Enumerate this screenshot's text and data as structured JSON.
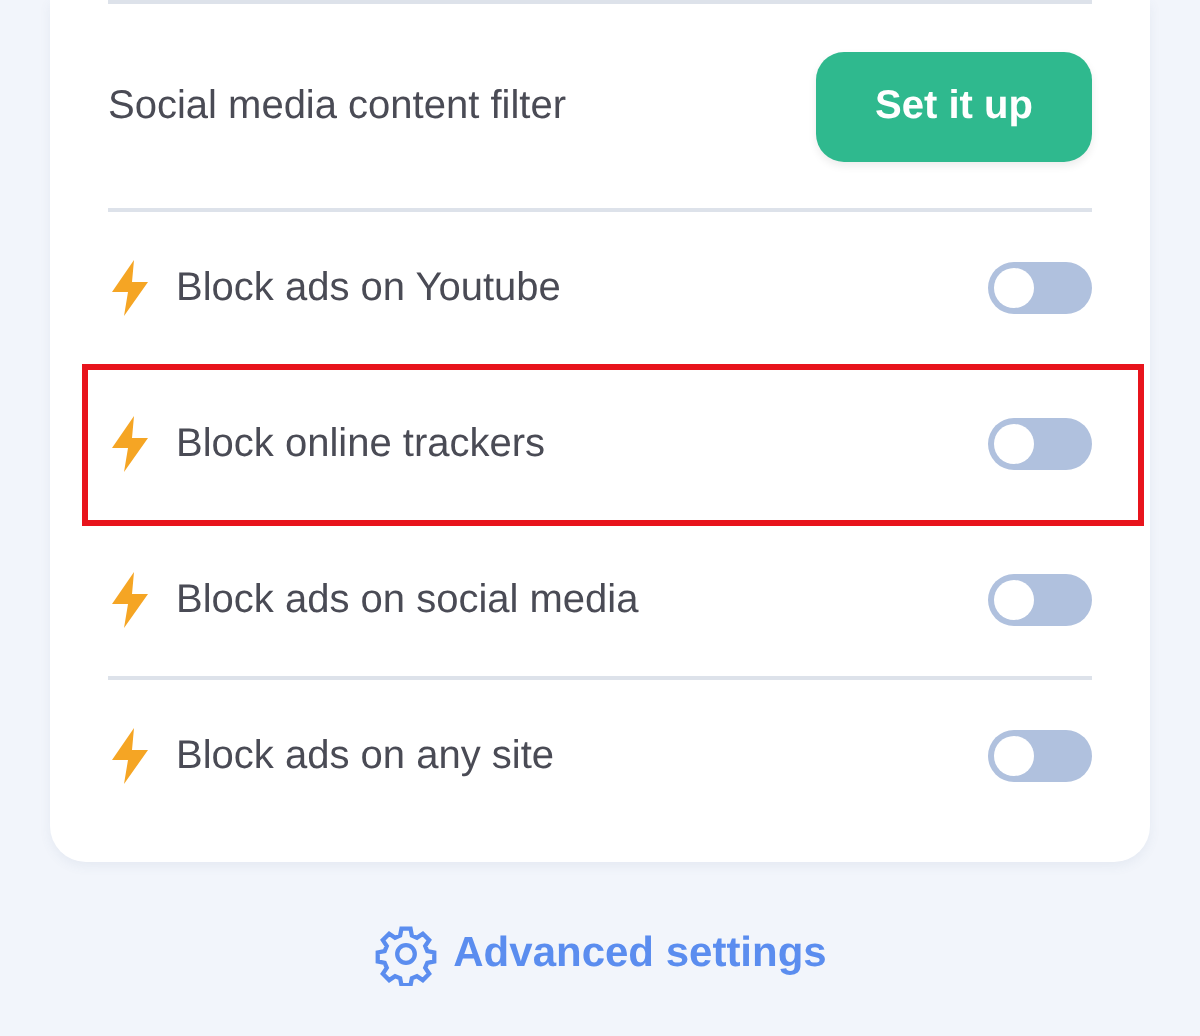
{
  "filter": {
    "label": "Social media content filter",
    "button": "Set it up"
  },
  "toggles": [
    {
      "label": "Block ads on Youtube",
      "on": false,
      "highlighted": false
    },
    {
      "label": "Block online trackers",
      "on": false,
      "highlighted": true
    },
    {
      "label": "Block ads on social media",
      "on": false,
      "highlighted": false
    },
    {
      "label": "Block ads on any site",
      "on": false,
      "highlighted": false
    }
  ],
  "advanced_link": "Advanced settings"
}
